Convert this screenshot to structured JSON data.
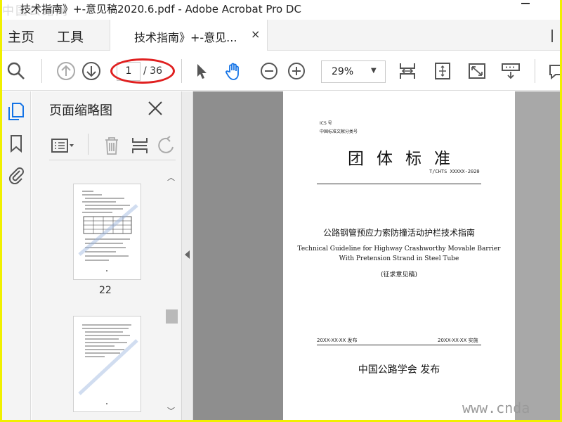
{
  "window": {
    "title": "技术指南》+-意见稿2020.6.pdf - Adobe Acrobat Pro DC",
    "overlay_text": "中国公路网"
  },
  "menubar": {
    "home": "主页",
    "tools": "工具",
    "tab_label": "技术指南》+-意见...",
    "tab_close": "×"
  },
  "toolbar": {
    "page_current": "1",
    "page_total": "/ 36",
    "zoom": "29%"
  },
  "thumbnails_panel": {
    "title": "页面缩略图",
    "thumb_label": "22"
  },
  "document_page": {
    "ics": "ICS 号",
    "classification": "中国标准文献分类号",
    "title": "团体标准",
    "code": "T/CHTS XXXXX-2020",
    "title_cn": "公路钢管预应力索防撞活动护栏技术指南",
    "title_en_line1": "Technical Guideline for Highway Crashworthy Movable Barrier",
    "title_en_line2": "With Pretension Strand in Steel Tube",
    "draft_note": "(征求意见稿)",
    "publish_date": "20XX-XX-XX 发布",
    "implement_date": "20XX-XX-XX 实施",
    "publisher": "中国公路学会  发布"
  },
  "watermark": "www.cnda",
  "colors": {
    "frame": "#f0f000",
    "accent_blue": "#1473e6",
    "annotation_red": "#e02020",
    "doc_background": "#8e8e8e"
  }
}
